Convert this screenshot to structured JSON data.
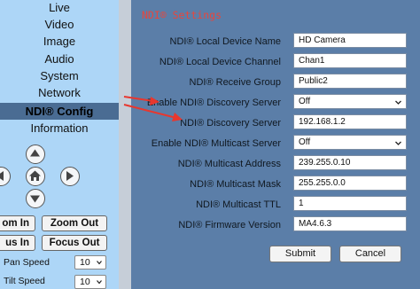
{
  "sidebar": {
    "items": [
      {
        "label": "Live"
      },
      {
        "label": "Video"
      },
      {
        "label": "Image"
      },
      {
        "label": "Audio"
      },
      {
        "label": "System"
      },
      {
        "label": "Network"
      },
      {
        "label": "NDI® Config"
      },
      {
        "label": "Information"
      }
    ],
    "active_index": 6,
    "ptz": {
      "up_icon": "arrow-up-icon",
      "down_icon": "arrow-down-icon",
      "left_icon": "arrow-left-icon",
      "right_icon": "arrow-right-icon",
      "home_icon": "home-icon"
    },
    "zoom_in_label": "om In",
    "zoom_out_label": "Zoom Out",
    "focus_in_label": "us In",
    "focus_out_label": "Focus Out",
    "pan_speed": {
      "label": "Pan Speed",
      "value": "10"
    },
    "tilt_speed": {
      "label": "Tilt Speed",
      "value": "10"
    }
  },
  "panel": {
    "title": "NDI® Settings",
    "rows": [
      {
        "label": "NDI® Local Device Name",
        "value": "HD Camera",
        "type": "text"
      },
      {
        "label": "NDI® Local Device Channel",
        "value": "Chan1",
        "type": "text"
      },
      {
        "label": "NDI® Receive Group",
        "value": "Public2",
        "type": "text"
      },
      {
        "label": "Enable NDI® Discovery Server",
        "value": "Off",
        "type": "select"
      },
      {
        "label": "NDI® Discovery Server",
        "value": "192.168.1.2",
        "type": "text"
      },
      {
        "label": "Enable NDI® Multicast Server",
        "value": "Off",
        "type": "select"
      },
      {
        "label": "NDI® Multicast Address",
        "value": "239.255.0.10",
        "type": "text"
      },
      {
        "label": "NDI® Multicast Mask",
        "value": "255.255.0.0",
        "type": "text"
      },
      {
        "label": "NDI® Multicast TTL",
        "value": "1",
        "type": "text"
      },
      {
        "label": "NDI® Firmware Version",
        "value": "MA4.6.3",
        "type": "text"
      }
    ],
    "submit_label": "Submit",
    "cancel_label": "Cancel"
  },
  "colors": {
    "sidebar_bg": "#ADD6F7",
    "active_item_bg": "#4A6C93",
    "panel_bg": "#5B7EA8",
    "title_color": "#E8463C",
    "annotation_arrow": "#E8372E"
  }
}
